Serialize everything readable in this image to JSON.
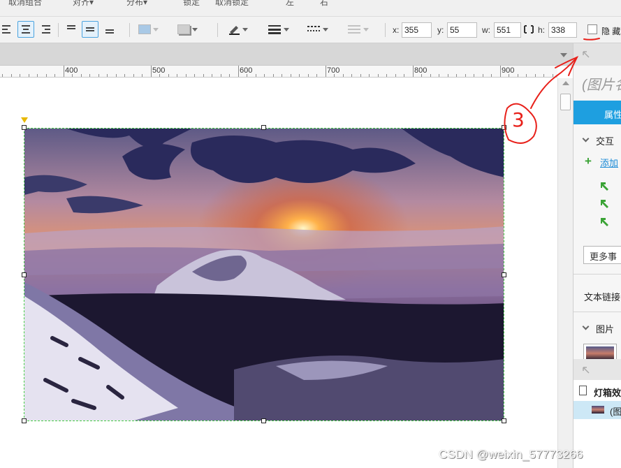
{
  "menu": {
    "items": [
      "取消组合",
      "对齐▾",
      "分布▾",
      "锁定",
      "取消锁定",
      "左",
      "右"
    ]
  },
  "toolbar": {
    "x_label": "x:",
    "x_value": "355",
    "y_label": "y:",
    "y_value": "55",
    "w_label": "w:",
    "w_value": "551",
    "h_label": "h:",
    "h_value": "338",
    "hide_label": "隐 藏"
  },
  "ruler": {
    "labels": [
      "400",
      "500",
      "600",
      "700",
      "800",
      "900"
    ]
  },
  "right_panel": {
    "title": "(图片名",
    "tab_label": "属性",
    "section_interaction": "交互",
    "add_case_link": "添加",
    "more_events_button": "更多事",
    "text_link_label": "文本链接",
    "section_image": "图片",
    "page_name": "灯箱效",
    "selected_item": "(图"
  },
  "annotation": {
    "handwritten_number": "③"
  },
  "watermark": "CSDN @weixin_57773266",
  "colors": {
    "accent": "#1e9fe0",
    "selection_border": "#44cc44",
    "annotation_red": "#e8201a"
  }
}
